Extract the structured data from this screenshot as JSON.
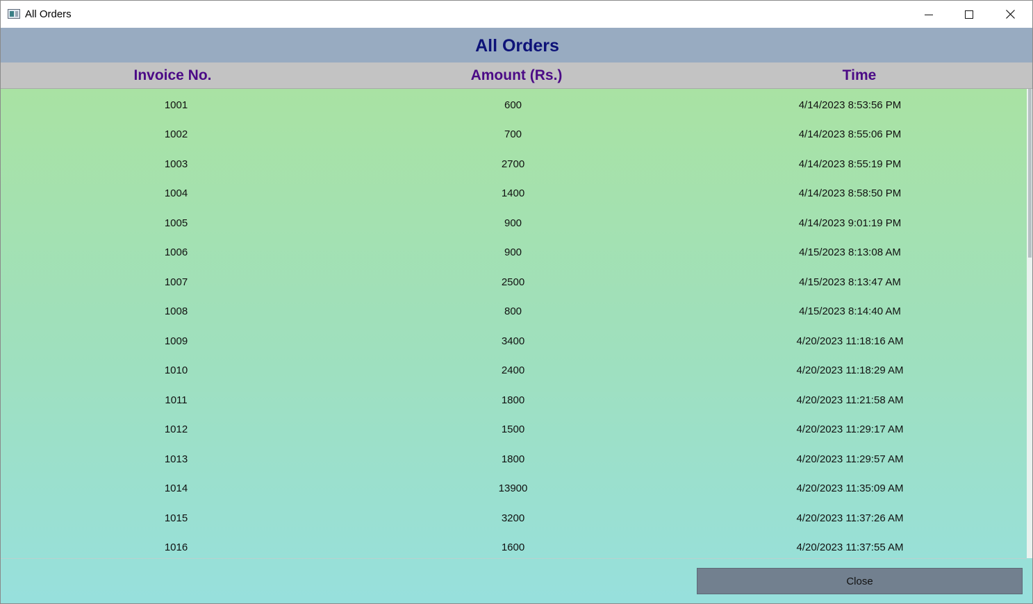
{
  "window": {
    "title": "All Orders",
    "controls": {
      "minimize": "minimize-icon",
      "maximize": "maximize-icon",
      "close": "close-icon"
    }
  },
  "header": {
    "title": "All Orders"
  },
  "table": {
    "columns": [
      "Invoice No.",
      "Amount (Rs.)",
      "Time"
    ],
    "rows": [
      {
        "invoice": "1001",
        "amount": "600",
        "time": "4/14/2023 8:53:56 PM"
      },
      {
        "invoice": "1002",
        "amount": "700",
        "time": "4/14/2023 8:55:06 PM"
      },
      {
        "invoice": "1003",
        "amount": "2700",
        "time": "4/14/2023 8:55:19 PM"
      },
      {
        "invoice": "1004",
        "amount": "1400",
        "time": "4/14/2023 8:58:50 PM"
      },
      {
        "invoice": "1005",
        "amount": "900",
        "time": "4/14/2023 9:01:19 PM"
      },
      {
        "invoice": "1006",
        "amount": "900",
        "time": "4/15/2023 8:13:08 AM"
      },
      {
        "invoice": "1007",
        "amount": "2500",
        "time": "4/15/2023 8:13:47 AM"
      },
      {
        "invoice": "1008",
        "amount": "800",
        "time": "4/15/2023 8:14:40 AM"
      },
      {
        "invoice": "1009",
        "amount": "3400",
        "time": "4/20/2023 11:18:16 AM"
      },
      {
        "invoice": "1010",
        "amount": "2400",
        "time": "4/20/2023 11:18:29 AM"
      },
      {
        "invoice": "1011",
        "amount": "1800",
        "time": "4/20/2023 11:21:58 AM"
      },
      {
        "invoice": "1012",
        "amount": "1500",
        "time": "4/20/2023 11:29:17 AM"
      },
      {
        "invoice": "1013",
        "amount": "1800",
        "time": "4/20/2023 11:29:57 AM"
      },
      {
        "invoice": "1014",
        "amount": "13900",
        "time": "4/20/2023 11:35:09 AM"
      },
      {
        "invoice": "1015",
        "amount": "3200",
        "time": "4/20/2023 11:37:26 AM"
      },
      {
        "invoice": "1016",
        "amount": "1600",
        "time": "4/20/2023 11:37:55 AM"
      }
    ]
  },
  "footer": {
    "close_label": "Close"
  },
  "colors": {
    "header_band": "#98abc1",
    "header_title": "#0d1278",
    "column_header_bg": "#c3c3c3",
    "column_header_text": "#4b0a86",
    "content_gradient_top": "#a9e2a3",
    "content_gradient_bottom": "#97e0dd",
    "close_button": "#72808f"
  }
}
